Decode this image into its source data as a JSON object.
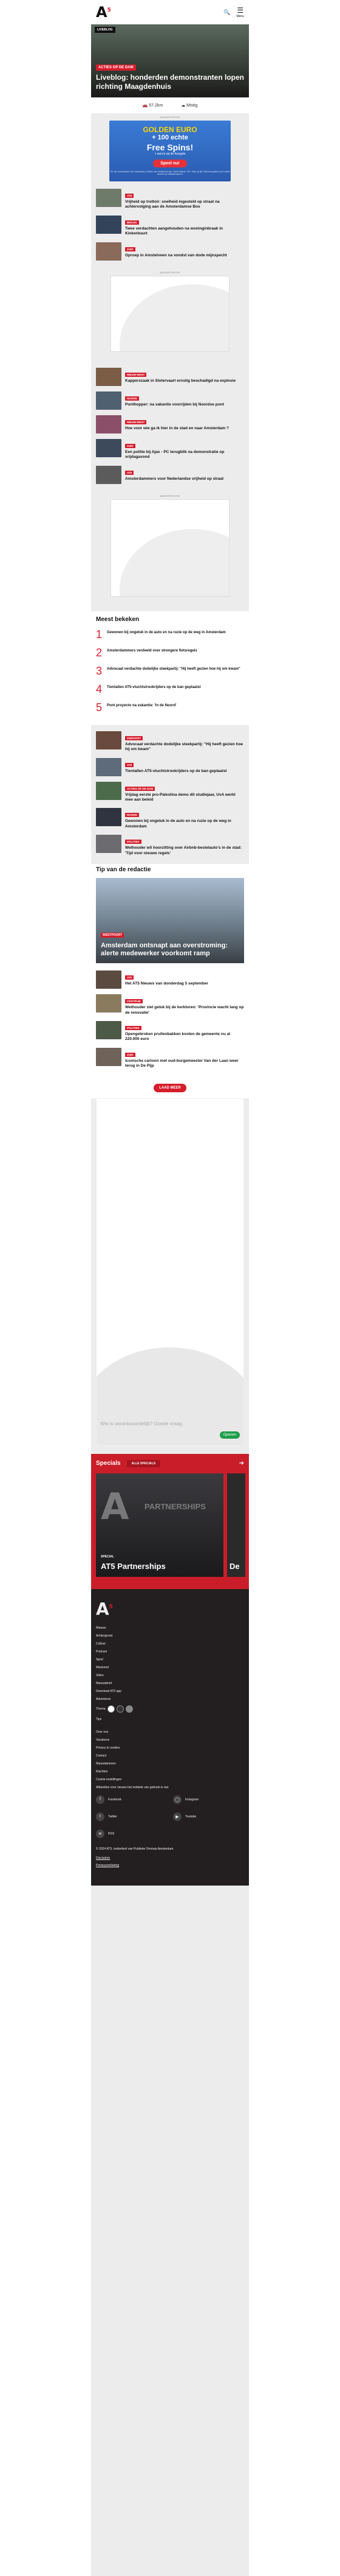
{
  "header": {
    "logo": "AT5",
    "menu_label": "Menu"
  },
  "hero": {
    "live": "LIVEBLOG",
    "tag": "ACTIES OP DE DAM",
    "title": "Liveblog: honderden demonstranten lopen richting Maagdenhuis"
  },
  "stats": {
    "traffic": "57.2km",
    "weather": "Mistig"
  },
  "ads": {
    "label": "ADVERTENTIE",
    "casino": {
      "top": "GOLDEN EURO",
      "amount": "+ 100 echte",
      "free": "Free Spins!",
      "sub": "+ euro's op de hoogste",
      "cta": "Speel nu!",
      "small": "*Er zijn voorwaarden van toepassing. Gokken kan verslavend zijn. Speel bewust. 18+. Stop op tijd. Wat kost gokken jou? Speel bewust op loketkansspel.nl"
    }
  },
  "news": [
    {
      "cat": "AT5",
      "title": "Vrijheid op trottoir: snelheid ingesteld op straat na achtervolging aan de Amsterdamse Bos"
    },
    {
      "cat": "BEKIJK",
      "title": "Twee verdachten aangehouden na woninginbraak in Kinkerbuurt"
    },
    {
      "cat": "ZUID",
      "title": "Oproep in Amstelveen na vondst van dode mijnspecht"
    }
  ],
  "news2": [
    {
      "cat": "NIEUW-WEST",
      "title": "Kapperszaak in Slotervaart ernstig beschadigd na explosie"
    },
    {
      "cat": "NOORD",
      "title": "Ponthopper: na vakantie voorrijden bij Noordse pont"
    },
    {
      "cat": "NIEUW-WEST",
      "title": "Hoe voor wie ga ik hier in de stad en naar Amsterdam ?"
    },
    {
      "cat": "ZUID",
      "title": "Een politie bij Ajax - PC terugblik na demonstratie op vrijdagavond"
    },
    {
      "cat": "AT5",
      "title": "Amsterdammers voor Nederlandse vrijheid op straat"
    }
  ],
  "meest": {
    "title": "Meest bekeken",
    "items": [
      "Gewonen bij ongeluk in de auto en na ruzie op de weg in Amsterdam",
      "Amsterdammers verdeeld over strengere fietsregels",
      "Advocaat verdachte dodelijke steekpartij: \"Hij heeft gezien hoe hij om kwam\"",
      "Tientallen AT5-vluchtstrookrijders op de ban geplaatst",
      "Pont proyecto na vakantie: 'In de Noord'"
    ]
  },
  "news3": [
    {
      "cat": "ZUIDOOST",
      "title": "Advocaat verdachte dodelijke steekpartij: \"Hij heeft gezien hoe hij om kwam\""
    },
    {
      "cat": "AT5",
      "title": "Tientallen AT5-vluchtstrookrijders op de ban geplaatst"
    },
    {
      "cat": "ACTIES OP DE DAM",
      "title": "Vrijdag eerste pro-Palestina demo dit studiejaar, UvA werkt mee aan beleid"
    },
    {
      "cat": "NOORD",
      "title": "Gewonen bij ongeluk in de auto en na ruzie op de weg in Amsterdam"
    },
    {
      "cat": "POLITIEK",
      "title": "Wethouder wil hoorzitting over Airbnb-bestelauto's in de stad: 'Tijd voor nieuwe regels'"
    }
  ],
  "tip": {
    "title": "Tip van de redactie",
    "tag": "WESTPOORT",
    "headline": "Amsterdam ontsnapt aan overstroming: alerte medewerker voorkomt ramp"
  },
  "tips": [
    {
      "cat": "AT5",
      "title": "Het AT5 Nieuws van donderdag 5 september"
    },
    {
      "cat": "CENTRUM",
      "title": "Wethouder ziet geluk bij de kerktoren: 'Provincie wacht lang op de renovatie'"
    },
    {
      "cat": "POLITIEK",
      "title": "Opengebroken prullenbakken kosten de gemeente nu al 220.000 euro"
    },
    {
      "cat": "ZUID",
      "title": "Iconische cartoon met oud-burgemeester Van der Laan weer terug in De Pijp"
    }
  ],
  "load_more": "LAAD MEER",
  "bigad": {
    "text": "Wie is verantwoordelijk? Goede vraag.",
    "cta": "Openen"
  },
  "specials": {
    "title": "Specials",
    "all": "ALLE SPECIALS",
    "card_lbl": "SPECIAL",
    "card_title": "AT5 Partnerships",
    "card_bg": "PARTNERSHIPS",
    "card2_title": "De"
  },
  "footer": {
    "links": [
      "Nieuws",
      "Achtergrond",
      "Cultuur",
      "Podcast",
      "Sport",
      "Weekend",
      "Video",
      "Nieuwsbrief",
      "Download AT5 app",
      "Adverteren",
      "Tips"
    ],
    "thema": "Thema",
    "links2": [
      "Over ons",
      "Vacatures",
      "Privacy & cookies",
      "Contact",
      "Nieuwsbrieven",
      "Klachten",
      "Cookie-instellingen"
    ],
    "note": "Afbeelden voor nieuws het mobiele van gebruik is van",
    "social": [
      "Facebook",
      "Instagram",
      "Twitter",
      "Youtube",
      "RSS"
    ],
    "copy": "© 2024 AT5, onderdeel van Publieke Omroep Amsterdam.",
    "disclaimer": "Disclaimer",
    "privacy": "Privacyverklaring"
  }
}
